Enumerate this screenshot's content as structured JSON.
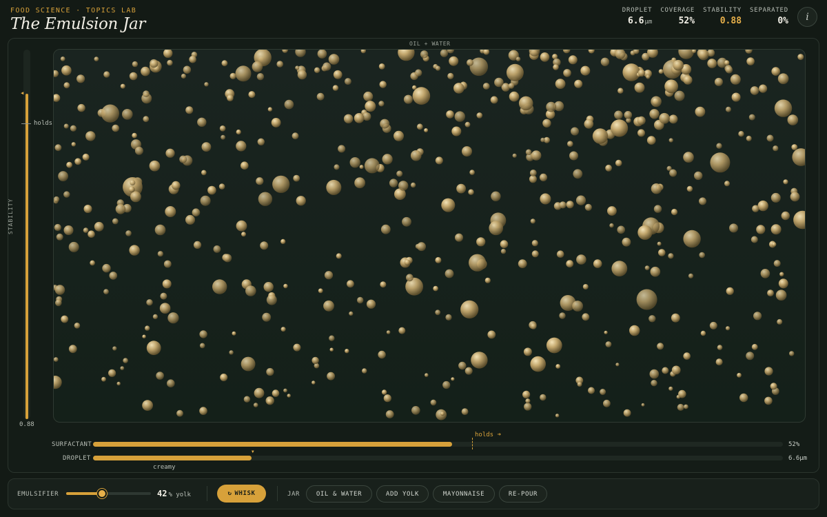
{
  "header": {
    "eyebrow": "FOOD SCIENCE · TOPICS LAB",
    "title": "The Emulsion Jar",
    "info_label": "i"
  },
  "stats": [
    {
      "label": "DROPLET",
      "value": "6.6",
      "unit": "µm",
      "accent": false
    },
    {
      "label": "COVERAGE",
      "value": "52%",
      "unit": "",
      "accent": false
    },
    {
      "label": "STABILITY",
      "value": "0.88",
      "unit": "",
      "accent": true
    },
    {
      "label": "SEPARATED",
      "value": "0%",
      "unit": "",
      "accent": false
    }
  ],
  "gauge": {
    "axis_label": "STABILITY",
    "value": 0.88,
    "value_text": "0.88",
    "threshold_label": "holds",
    "threshold": 0.8
  },
  "jar": {
    "caption": "OIL + WATER",
    "droplet_color": "#c9b07a"
  },
  "bars": {
    "surfactant": {
      "label": "SURFACTANT",
      "fraction": 0.52,
      "value_text": "52%",
      "threshold_label": "holds ➜",
      "threshold": 0.55
    },
    "droplet": {
      "label": "DROPLET",
      "fraction": 0.23,
      "value_text": "6.6µm",
      "zone_label": "creamy"
    }
  },
  "controls": {
    "emulsifier_label": "EMULSIFIER",
    "emulsifier_value": "42",
    "emulsifier_unit": "% yolk",
    "emulsifier_fraction": 0.42,
    "whisk_icon": "↻",
    "whisk_label": "WHISK",
    "jar_label": "JAR",
    "presets": [
      "OIL & WATER",
      "ADD YOLK",
      "MAYONNAISE",
      "RE-POUR"
    ]
  },
  "colors": {
    "accent": "#d7a13a",
    "background": "#131a15"
  }
}
